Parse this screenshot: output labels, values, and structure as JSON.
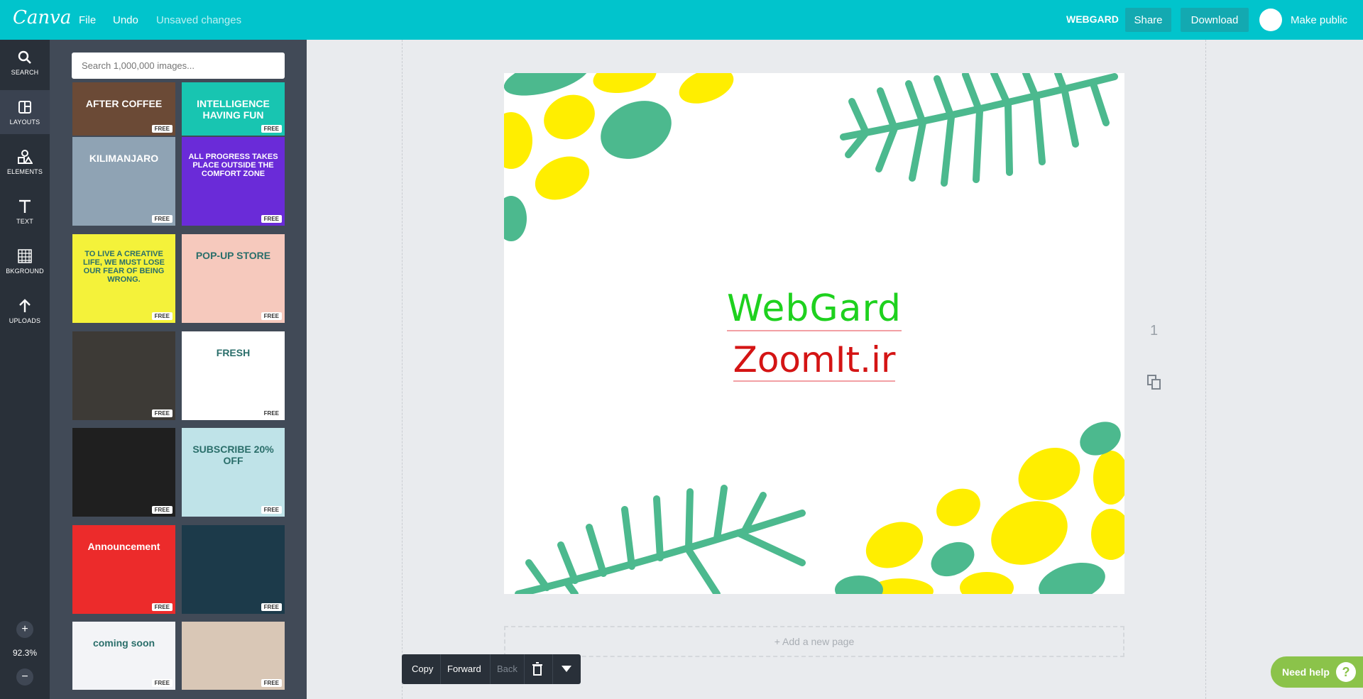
{
  "topbar": {
    "logo": "Canva",
    "menu": {
      "file": "File",
      "undo": "Undo",
      "status": "Unsaved changes"
    },
    "team": "WEBGARD",
    "share": "Share",
    "download": "Download",
    "make_public": "Make public",
    "accent": "#01c4cc"
  },
  "sidebar": {
    "items": [
      {
        "label": "SEARCH",
        "icon": "search-icon"
      },
      {
        "label": "LAYOUTS",
        "icon": "layouts-icon"
      },
      {
        "label": "ELEMENTS",
        "icon": "elements-icon"
      },
      {
        "label": "TEXT",
        "icon": "text-icon"
      },
      {
        "label": "BKGROUND",
        "icon": "background-icon"
      },
      {
        "label": "UPLOADS",
        "icon": "upload-icon"
      }
    ],
    "zoom": "92.3%",
    "zoom_in": "+",
    "zoom_out": "−"
  },
  "panel": {
    "search_placeholder": "Search 1,000,000 images...",
    "free_badge": "FREE",
    "layouts": [
      {
        "text": "AFTER COFFEE",
        "bg": "#6b4a36"
      },
      {
        "text": "INTELLIGENCE HAVING FUN",
        "bg": "#18c5b1"
      },
      {
        "text": "KILIMANJARO",
        "bg": "#8fa3b4"
      },
      {
        "text": "ALL PROGRESS TAKES PLACE OUTSIDE THE COMFORT ZONE",
        "bg": "#6a2bd8"
      },
      {
        "text": "TO LIVE A CREATIVE LIFE, WE MUST LOSE OUR FEAR OF BEING WRONG.",
        "bg": "#f4f23a"
      },
      {
        "text": "POP-UP STORE",
        "bg": "#f6c9bd"
      },
      {
        "text": "",
        "bg": "#3d3a36"
      },
      {
        "text": "FRESH",
        "bg": "#ffffff"
      },
      {
        "text": "",
        "bg": "#1f1f1f"
      },
      {
        "text": "SUBSCRIBE 20% OFF",
        "bg": "#bfe3e8"
      },
      {
        "text": "Announcement",
        "bg": "#ec2b2b"
      },
      {
        "text": "",
        "bg": "#1c3a4a"
      },
      {
        "text": "coming soon",
        "bg": "#f3f4f7"
      },
      {
        "text": "",
        "bg": "#d9c7b6"
      }
    ]
  },
  "canvas": {
    "title": "WebGard",
    "subtitle": "ZoomIt.ir",
    "page_number": "1",
    "add_page": "+ Add a new page",
    "colors": {
      "title": "#1ed11e",
      "subtitle": "#d41414",
      "leaf": "#4cb98e",
      "dot": "#ffee00"
    }
  },
  "context_toolbar": {
    "copy": "Copy",
    "forward": "Forward",
    "back": "Back"
  },
  "help": {
    "label": "Need help",
    "icon": "?"
  }
}
